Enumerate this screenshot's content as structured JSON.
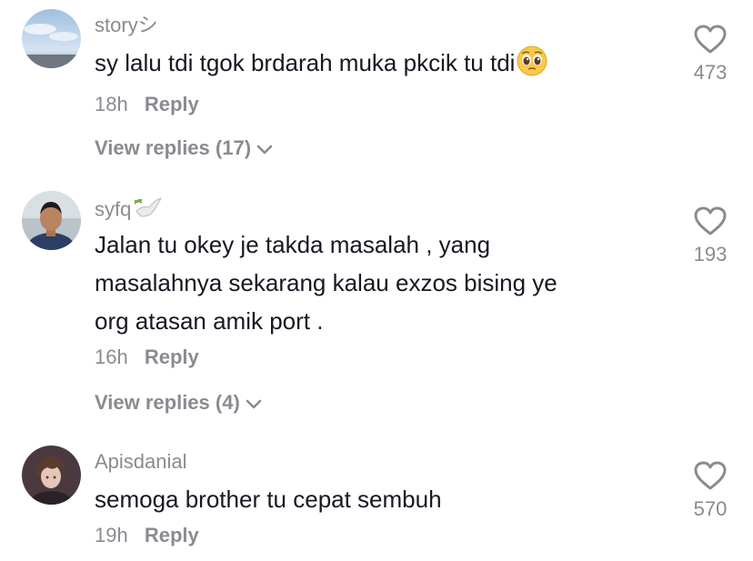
{
  "comments": [
    {
      "username": "storyシ",
      "text_lines": [
        "sy lalu tdi tgok brdarah muka pkcik tu tdi"
      ],
      "emoji": "pleading-face",
      "time": "18h",
      "reply_label": "Reply",
      "view_replies": "View replies (17)",
      "likes": "473"
    },
    {
      "username": "syfq",
      "username_extra": "dove-with-olive-branch",
      "text_lines": [
        "Jalan tu okey je takda masalah , yang",
        "masalahnya sekarang kalau exzos bising ye",
        "org atasan amik port ."
      ],
      "time": "16h",
      "reply_label": "Reply",
      "view_replies": "View replies (4)",
      "likes": "193"
    },
    {
      "username": "Apisdanial",
      "text_lines": [
        "semoga brother tu cepat sembuh"
      ],
      "time": "19h",
      "reply_label": "Reply",
      "likes": "570"
    }
  ],
  "colors": {
    "text_primary": "#161823",
    "text_secondary": "#8a8b91",
    "background": "#ffffff"
  }
}
